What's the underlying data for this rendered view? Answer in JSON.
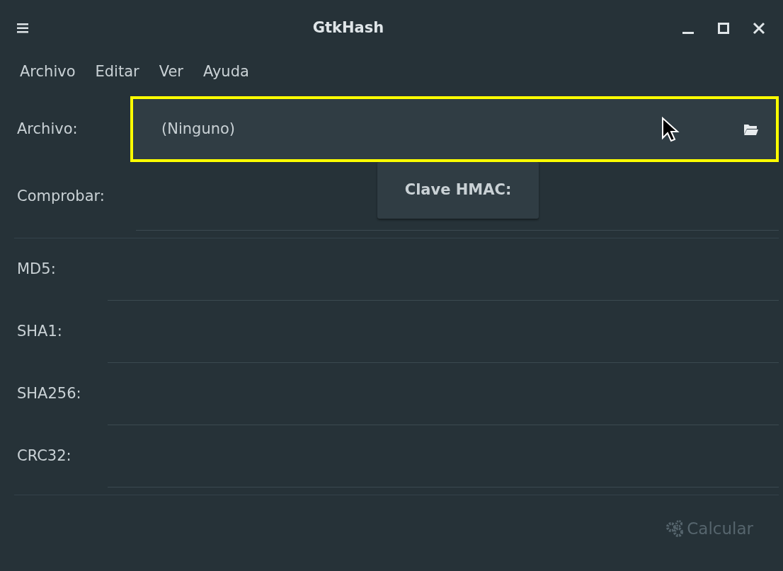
{
  "window": {
    "title": "GtkHash"
  },
  "menu": [
    "Archivo",
    "Editar",
    "Ver",
    "Ayuda"
  ],
  "file_row": {
    "label": "Archivo:",
    "value": "(Ninguno)",
    "highlighted": true
  },
  "check_row": {
    "label": "Comprobar:"
  },
  "tooltip": {
    "text": "Clave HMAC:"
  },
  "hashes": [
    {
      "label": "MD5:"
    },
    {
      "label": "SHA1:"
    },
    {
      "label": "SHA256:"
    },
    {
      "label": "CRC32:"
    }
  ],
  "calculate_button": {
    "label": "Calcular",
    "disabled": true
  }
}
